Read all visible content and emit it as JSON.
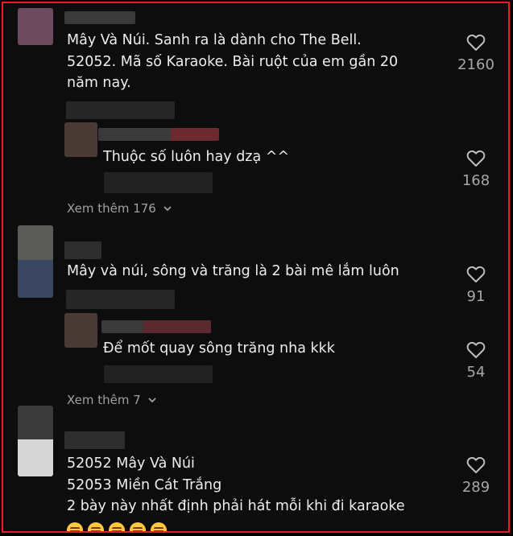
{
  "comments": [
    {
      "lines": [
        "Mây Và Núi. Sanh ra là dành cho The Bell.",
        "52052. Mã số Karaoke. Bài ruột của em gần 20",
        "năm nay."
      ],
      "likes": "2160",
      "reply": {
        "text": "Thuộc số luôn hay dzạ ^^",
        "likes": "168"
      },
      "more": "Xem thêm 176"
    },
    {
      "lines": [
        "Mây và núi, sông và trăng là 2 bài mê lắm luôn"
      ],
      "likes": "91",
      "reply": {
        "text": "Để mốt quay sông trăng nha kkk",
        "likes": "54"
      },
      "more": "Xem thêm 7"
    },
    {
      "lines": [
        "52052 Mây Và Núi",
        "52053 Miền Cát Trắng",
        "2 bày này nhất định phải hát mỗi khi đi karaoke"
      ],
      "likes": "289",
      "emoji_count": 5
    }
  ],
  "icons": {
    "like": "heart-outline-icon",
    "expand": "chevron-down-icon",
    "emoji": "grinning-face-icon"
  },
  "colors": {
    "frame_border": "#ee1c25",
    "background": "#0d0d0d"
  }
}
